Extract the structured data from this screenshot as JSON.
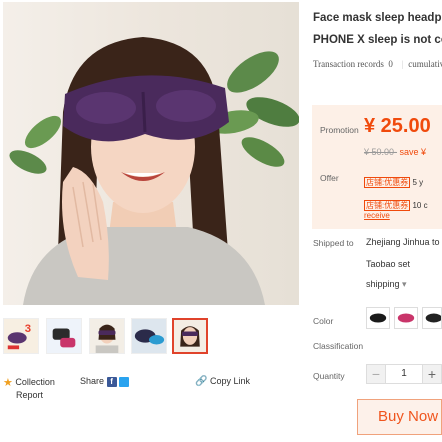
{
  "product": {
    "title_line1": "Face mask sleep headphones",
    "title_line2": "PHONE X sleep is not comfortable",
    "records_label": "Transaction records",
    "records_count": "0",
    "records_tail": "cumulative"
  },
  "price": {
    "promotion_label": "Promotion",
    "promotion_price": "¥ 25.00",
    "original_price": "¥ 50.00-",
    "save_text": "save ¥",
    "offer_label": "Offer",
    "coupons": [
      {
        "tag": "店铺:优惠券",
        "rest": "5 y"
      },
      {
        "tag": "店铺:优惠券",
        "rest": "10 c"
      }
    ],
    "receive_label": "receive"
  },
  "shipping": {
    "label": "Shipped to",
    "origin": "Zhejiang Jinhua to",
    "destination": "Taobao set",
    "method": "shipping",
    "dropdown_caret": "▾"
  },
  "options": {
    "color_label": "Color",
    "classification_label": "Classification",
    "quantity_label": "Quantity",
    "quantity_value": "1",
    "minus": "−",
    "plus": "+"
  },
  "actions": {
    "collection": "Collection",
    "report": "Report",
    "share": "Share",
    "copy_link": "Copy Link",
    "buy_now": "Buy Now"
  },
  "colors": {
    "accent": "#f04a0c",
    "price_bg": "#fdf0e7",
    "mask_purple": "#4a2a5c"
  }
}
